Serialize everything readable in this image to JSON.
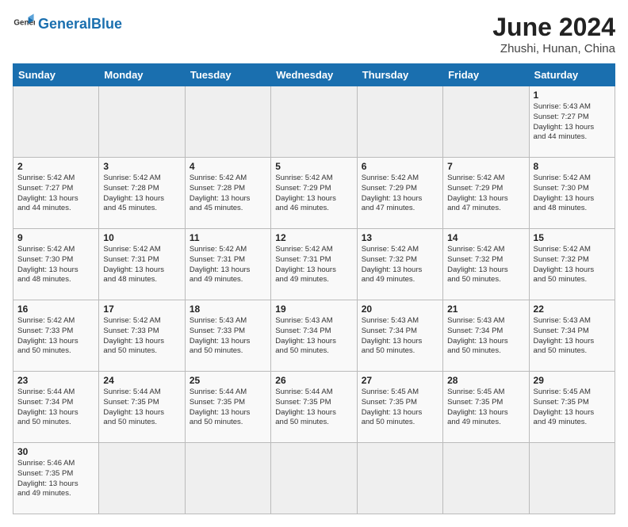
{
  "header": {
    "logo_general": "General",
    "logo_blue": "Blue",
    "month_year": "June 2024",
    "location": "Zhushi, Hunan, China"
  },
  "weekdays": [
    "Sunday",
    "Monday",
    "Tuesday",
    "Wednesday",
    "Thursday",
    "Friday",
    "Saturday"
  ],
  "weeks": [
    [
      {
        "day": "",
        "info": ""
      },
      {
        "day": "",
        "info": ""
      },
      {
        "day": "",
        "info": ""
      },
      {
        "day": "",
        "info": ""
      },
      {
        "day": "",
        "info": ""
      },
      {
        "day": "",
        "info": ""
      },
      {
        "day": "1",
        "info": "Sunrise: 5:43 AM\nSunset: 7:27 PM\nDaylight: 13 hours\nand 44 minutes."
      }
    ],
    [
      {
        "day": "2",
        "info": "Sunrise: 5:42 AM\nSunset: 7:27 PM\nDaylight: 13 hours\nand 44 minutes."
      },
      {
        "day": "3",
        "info": "Sunrise: 5:42 AM\nSunset: 7:28 PM\nDaylight: 13 hours\nand 45 minutes."
      },
      {
        "day": "4",
        "info": "Sunrise: 5:42 AM\nSunset: 7:28 PM\nDaylight: 13 hours\nand 45 minutes."
      },
      {
        "day": "5",
        "info": "Sunrise: 5:42 AM\nSunset: 7:29 PM\nDaylight: 13 hours\nand 46 minutes."
      },
      {
        "day": "6",
        "info": "Sunrise: 5:42 AM\nSunset: 7:29 PM\nDaylight: 13 hours\nand 47 minutes."
      },
      {
        "day": "7",
        "info": "Sunrise: 5:42 AM\nSunset: 7:29 PM\nDaylight: 13 hours\nand 47 minutes."
      },
      {
        "day": "8",
        "info": "Sunrise: 5:42 AM\nSunset: 7:30 PM\nDaylight: 13 hours\nand 48 minutes."
      }
    ],
    [
      {
        "day": "9",
        "info": "Sunrise: 5:42 AM\nSunset: 7:30 PM\nDaylight: 13 hours\nand 48 minutes."
      },
      {
        "day": "10",
        "info": "Sunrise: 5:42 AM\nSunset: 7:31 PM\nDaylight: 13 hours\nand 48 minutes."
      },
      {
        "day": "11",
        "info": "Sunrise: 5:42 AM\nSunset: 7:31 PM\nDaylight: 13 hours\nand 49 minutes."
      },
      {
        "day": "12",
        "info": "Sunrise: 5:42 AM\nSunset: 7:31 PM\nDaylight: 13 hours\nand 49 minutes."
      },
      {
        "day": "13",
        "info": "Sunrise: 5:42 AM\nSunset: 7:32 PM\nDaylight: 13 hours\nand 49 minutes."
      },
      {
        "day": "14",
        "info": "Sunrise: 5:42 AM\nSunset: 7:32 PM\nDaylight: 13 hours\nand 50 minutes."
      },
      {
        "day": "15",
        "info": "Sunrise: 5:42 AM\nSunset: 7:32 PM\nDaylight: 13 hours\nand 50 minutes."
      }
    ],
    [
      {
        "day": "16",
        "info": "Sunrise: 5:42 AM\nSunset: 7:33 PM\nDaylight: 13 hours\nand 50 minutes."
      },
      {
        "day": "17",
        "info": "Sunrise: 5:42 AM\nSunset: 7:33 PM\nDaylight: 13 hours\nand 50 minutes."
      },
      {
        "day": "18",
        "info": "Sunrise: 5:43 AM\nSunset: 7:33 PM\nDaylight: 13 hours\nand 50 minutes."
      },
      {
        "day": "19",
        "info": "Sunrise: 5:43 AM\nSunset: 7:34 PM\nDaylight: 13 hours\nand 50 minutes."
      },
      {
        "day": "20",
        "info": "Sunrise: 5:43 AM\nSunset: 7:34 PM\nDaylight: 13 hours\nand 50 minutes."
      },
      {
        "day": "21",
        "info": "Sunrise: 5:43 AM\nSunset: 7:34 PM\nDaylight: 13 hours\nand 50 minutes."
      },
      {
        "day": "22",
        "info": "Sunrise: 5:43 AM\nSunset: 7:34 PM\nDaylight: 13 hours\nand 50 minutes."
      }
    ],
    [
      {
        "day": "23",
        "info": "Sunrise: 5:44 AM\nSunset: 7:34 PM\nDaylight: 13 hours\nand 50 minutes."
      },
      {
        "day": "24",
        "info": "Sunrise: 5:44 AM\nSunset: 7:35 PM\nDaylight: 13 hours\nand 50 minutes."
      },
      {
        "day": "25",
        "info": "Sunrise: 5:44 AM\nSunset: 7:35 PM\nDaylight: 13 hours\nand 50 minutes."
      },
      {
        "day": "26",
        "info": "Sunrise: 5:44 AM\nSunset: 7:35 PM\nDaylight: 13 hours\nand 50 minutes."
      },
      {
        "day": "27",
        "info": "Sunrise: 5:45 AM\nSunset: 7:35 PM\nDaylight: 13 hours\nand 50 minutes."
      },
      {
        "day": "28",
        "info": "Sunrise: 5:45 AM\nSunset: 7:35 PM\nDaylight: 13 hours\nand 49 minutes."
      },
      {
        "day": "29",
        "info": "Sunrise: 5:45 AM\nSunset: 7:35 PM\nDaylight: 13 hours\nand 49 minutes."
      }
    ],
    [
      {
        "day": "30",
        "info": "Sunrise: 5:46 AM\nSunset: 7:35 PM\nDaylight: 13 hours\nand 49 minutes."
      },
      {
        "day": "",
        "info": ""
      },
      {
        "day": "",
        "info": ""
      },
      {
        "day": "",
        "info": ""
      },
      {
        "day": "",
        "info": ""
      },
      {
        "day": "",
        "info": ""
      },
      {
        "day": "",
        "info": ""
      }
    ]
  ]
}
